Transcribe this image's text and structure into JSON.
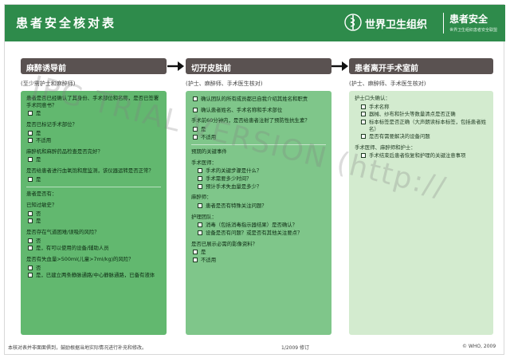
{
  "header": {
    "title": "患者安全核对表",
    "who_name": "世界卫生组织",
    "ps_title": "患者安全",
    "ps_sub": "世界卫生组织患者安全联盟"
  },
  "watermark": "JPG TRIAL VERSION (http://",
  "columns": [
    {
      "title": "麻醉诱导前",
      "subtitle": "(至少需护士和麻醉师)",
      "blocks": [
        {
          "question": "患者是否已经确认了其身份、手术部位和名称，是否已签署手术同意书？",
          "options": [
            "是"
          ]
        },
        {
          "question": "是否已标记手术部位？",
          "options": [
            "是",
            "不适用"
          ]
        },
        {
          "question": "麻醉机和麻醉药品检查是否完好？",
          "options": [
            "是"
          ]
        },
        {
          "question": "是否给患者进行血氧饱和度监测，该仪器运转是否正常？",
          "options": [
            "是"
          ]
        },
        {
          "divider": true,
          "question": "患者是否有："
        },
        {
          "question": "已知过敏史？",
          "options": [
            "否",
            "是"
          ]
        },
        {
          "question": "是否存在气道困难/误吸的风险？",
          "options": [
            "否",
            "是，有可以使用的设备/辅助人员"
          ]
        },
        {
          "question": "是否有失血量>500ml(儿童>7ml/kg)的风险？",
          "options": [
            "否",
            "是，已建立两条静脉通路/中心静脉通路，已备有液体"
          ]
        }
      ]
    },
    {
      "title": "切开皮肤前",
      "subtitle": "(护士、麻醉师、手术医生核对)",
      "blocks": [
        {
          "options": [
            "确认团队的所有成员都已自我介绍其姓名和职责"
          ]
        },
        {
          "options": [
            "确认患者姓名、手术名称和手术部位"
          ]
        },
        {
          "question": "手术前60分钟内，是否给患者注射了预防性抗生素？",
          "options": [
            "是",
            "不适用"
          ]
        },
        {
          "divider": true,
          "question": "预期的关键事件"
        },
        {
          "question": "手术医师：",
          "sub": true,
          "options": [
            "手术的关键步骤是什么？",
            "手术需要多少时间？",
            "预计手术失血量是多少？"
          ]
        },
        {
          "question": "麻醉师：",
          "sub": true,
          "options": [
            "患者是否有特殊关注问题？"
          ]
        },
        {
          "question": "护理团队：",
          "sub": true,
          "options": [
            "消毒（包括消毒指示器结果）是否确认？",
            "设备是否有问题？或是否有其他关注要点？"
          ]
        },
        {
          "question": "是否已展示必需的影像资料？",
          "options": [
            "是",
            "不适用"
          ]
        }
      ]
    },
    {
      "title": "患者离开手术室前",
      "subtitle": "(护士、麻醉师、手术医生核对)",
      "blocks": [
        {
          "question": "护士口头确认：",
          "sub": true,
          "options": [
            "手术名称",
            "器械、纱布和针头等数量清点是否正确",
            "标本标签是否正确（大声朗读标本标签，包括患者姓名）",
            "是否有需要解决的设备问题"
          ]
        },
        {
          "question": "手术医师、麻醉师和护士：",
          "sub": true,
          "options": [
            "手术结束后患者恢复和护理的关键注意事项"
          ]
        }
      ]
    }
  ],
  "footer": {
    "left": "本核对表并非面面俱到，鼓励根据当地实际情况进行补充和修改。",
    "center": "1/2009 修订",
    "right": "© WHO, 2009"
  }
}
